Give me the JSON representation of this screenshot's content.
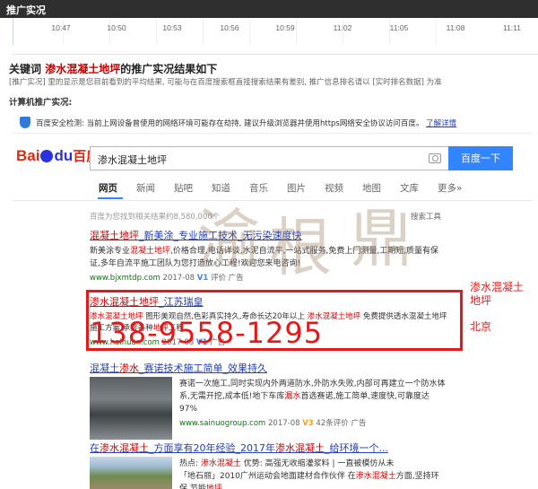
{
  "app": {
    "title": "推广实况"
  },
  "timeline": {
    "ticks": [
      "10:47",
      "10:50",
      "10:53",
      "10:56",
      "10:59",
      "11:02",
      "11:05",
      "11:08",
      "11:11"
    ]
  },
  "summary": {
    "title_prefix": "关键词",
    "keyword": "渗水混凝土地坪",
    "title_suffix": "的推广实况结果如下",
    "note": "[推广实况] 里的显示是您目前看到的平均结果, 可能与在百度搜索框直接搜索结果有差别, 推广信息排名请以 [实时排名数据] 为准",
    "pc_label": "计算机推广实况:"
  },
  "security_bar": {
    "text": "百度安全检测: 当前上网设备曾使用的网络环境可能存在劫持, 建议升级浏览器并使用https网络安全协议访问百度。",
    "link": "了解详情"
  },
  "baidu": {
    "logo_bai": "Bai",
    "logo_du": "du",
    "logo_cn": "百度",
    "search_value": "渗水混凝土地坪",
    "search_button": "百度一下",
    "tabs": [
      "网页",
      "新闻",
      "贴吧",
      "知道",
      "音乐",
      "图片",
      "视频",
      "地图",
      "文库",
      "更多»"
    ],
    "stats": "百度为您找到相关结果约8,580,000个",
    "tools": "搜索工具"
  },
  "results": [
    {
      "title_em": "混凝土地坪",
      "title_rest": "_新美涂_专业施工技术_无污染速度快",
      "snippet_a": "新美涂专业",
      "snippet_em": "混凝土地坪",
      "snippet_b": ",价格合理,电话详谈,水泥自流平,一站式服务,免费上门测量,工期短,质量有保证,多年自流平施工团队为您打造放心工程!欢迎您来电咨询!",
      "url": "www.bjxmtdp.com",
      "date": "2017-08",
      "v": "V1",
      "eval": "评价",
      "ad": "广告"
    },
    {
      "title_em": "渗水混凝土地坪",
      "title_rest": "_江苏瑞皇",
      "snippet_em": "渗水混凝土地坪",
      "snippet_a": " 图形美观自然,色彩真实持久,寿命长达20年以上 ",
      "snippet_em2": "渗水混凝土地坪",
      "snippet_b": " 免费提供透水混凝土地坪施工方案,承接各种",
      "snippet_em3": "地坪",
      "snippet_c": "工程",
      "url": "www.haihuan.com",
      "date": "2017-08",
      "v": "V1",
      "ad": "广告"
    },
    {
      "title_a": "混凝土",
      "title_em": "渗水",
      "title_rest": "_赛诺技术施工简单_效果持久",
      "snippet": "赛诺一次施工,同时实现内外两道防水,外防水失败,内部可再建立一个防水体系,无需开挖,成本低!地下车库",
      "snippet_em": "漏水",
      "snippet_b": "首选赛诺,施工简单,速度快,可靠度达97%",
      "url": "www.sainuogroup.com",
      "date": "2017-08",
      "v": "V3",
      "eval": "42条评价",
      "ad": "广告"
    },
    {
      "title_a": "在",
      "title_em": "渗水混凝土",
      "title_b": "_方面享有20年经验_2017年",
      "title_em2": "渗水混凝土",
      "title_c": "_给环境一个...",
      "snippet_a": "热点: ",
      "snippet_em": "渗水混凝土",
      "snippet_b": "  优势: 高强无收缩灌浆料 | 一直被模仿从未",
      "snippet_c": "「地石丽」2010广州运动会地面建材合作伙伴 在",
      "snippet_em2": "渗水混凝土",
      "snippet_d": "方面,坚持环保,节能",
      "snippet_em3": "地坪"
    }
  ],
  "overlay": {
    "watermark": [
      "渝",
      "根",
      "鼎"
    ],
    "phone": "138-9558-1295",
    "side_line1": "渗水混凝土",
    "side_line2": "地坪",
    "side_city": "北京"
  },
  "colors": {
    "accent": "#3385ff",
    "highlight_red": "#e81717",
    "link_blue": "#2440b3",
    "url_green": "#008000"
  }
}
